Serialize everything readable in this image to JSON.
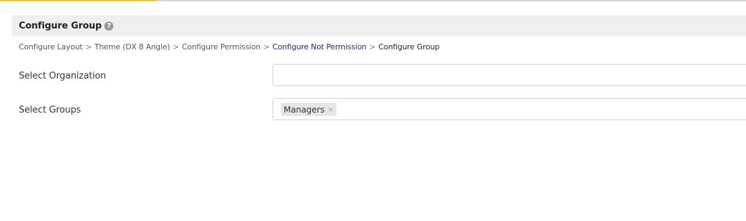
{
  "loading_bar": {
    "progress": 0.21,
    "color": "#f0c24a"
  },
  "panel": {
    "title": "Configure Group",
    "help_icon": "question-circle-icon",
    "help_glyph": "?"
  },
  "breadcrumb": {
    "separator": ">",
    "items": [
      "Configure Layout",
      "Theme (DX 8 Angle)",
      "Configure Permission",
      "Configure Not Permission",
      "Configure Group"
    ]
  },
  "form": {
    "organization": {
      "label": "Select Organization",
      "value": ""
    },
    "groups": {
      "label": "Select Groups",
      "tags": [
        {
          "label": "Managers",
          "remove_glyph": "×"
        }
      ]
    }
  }
}
